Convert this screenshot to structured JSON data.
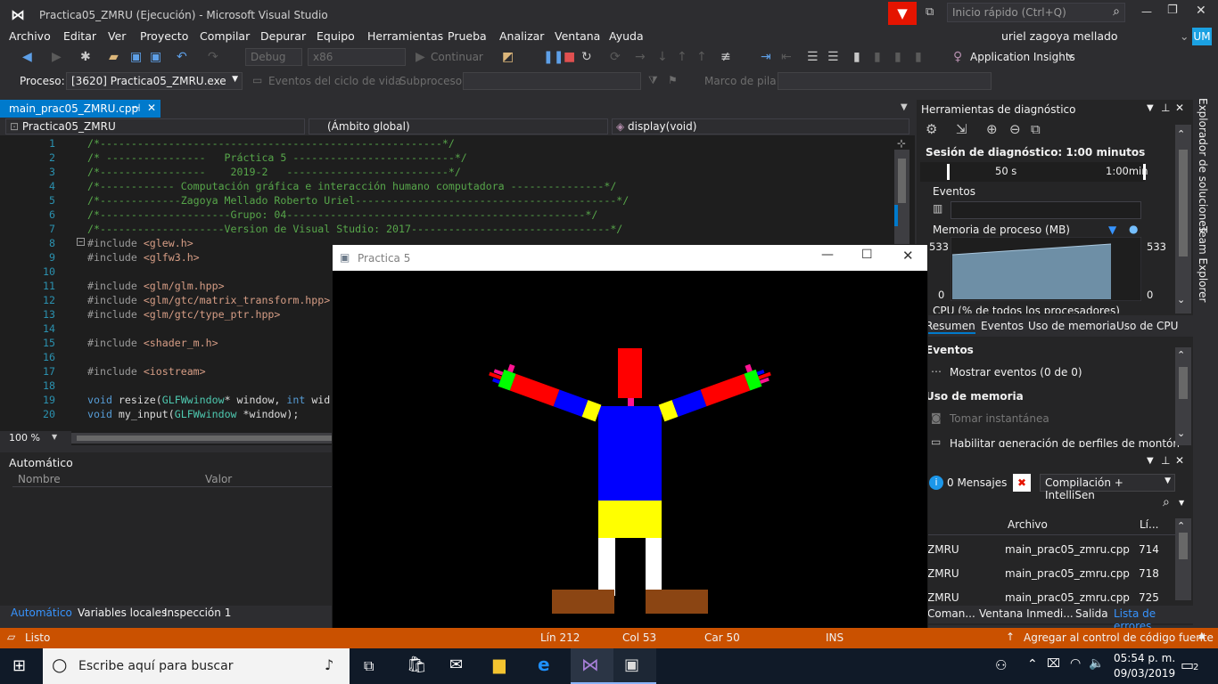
{
  "app": {
    "title": "Practica05_ZMRU (Ejecución) - Microsoft Visual Studio",
    "quick_launch_placeholder": "Inicio rápido (Ctrl+Q)",
    "user": "uriel zagoya mellado",
    "user_initials": "UM"
  },
  "menu": [
    "Archivo",
    "Editar",
    "Ver",
    "Proyecto",
    "Compilar",
    "Depurar",
    "Equipo",
    "Herramientas",
    "Prueba",
    "Analizar",
    "Ventana",
    "Ayuda"
  ],
  "toolbar": {
    "config": "Debug",
    "platform": "x86",
    "continue_label": "Continuar",
    "app_insights": "Application Insights"
  },
  "procbar": {
    "proceso_label": "Proceso:",
    "proceso_value": "[3620] Practica05_ZMRU.exe",
    "eventos_label": "Eventos del ciclo de vida",
    "subproceso_label": "Subproceso:",
    "marco_label": "Marco de pila:"
  },
  "editor": {
    "tab": "main_prac05_ZMRU.cpp",
    "nav_project": "Practica05_ZMRU",
    "nav_scope": "(Ámbito global)",
    "nav_func": "display(void)",
    "zoom": "100 %",
    "lines": [
      {
        "n": "1",
        "t": "/*-------------------------------------------------------*/",
        "c": "cm"
      },
      {
        "n": "2",
        "t": "/* ----------------   Práctica 5 --------------------------*/",
        "c": "cm"
      },
      {
        "n": "3",
        "t": "/*-----------------    2019-2   --------------------------*/",
        "c": "cm"
      },
      {
        "n": "4",
        "t": "/*------------ Computación gráfica e interacción humano computadora ---------------*/",
        "c": "cm"
      },
      {
        "n": "5",
        "t": "/*-------------Zagoya Mellado Roberto Uriel------------------------------------------*/",
        "c": "cm"
      },
      {
        "n": "6",
        "t": "/*---------------------Grupo: 04------------------------------------------------*/",
        "c": "cm"
      },
      {
        "n": "7",
        "t": "/*--------------------Version de Visual Studio: 2017--------------------------------*/",
        "c": "cm"
      },
      {
        "n": "8",
        "t": "#include <glew.h>",
        "c": "inc"
      },
      {
        "n": "9",
        "t": "#include <glfw3.h>",
        "c": "inc"
      },
      {
        "n": "10",
        "t": "",
        "c": "pl"
      },
      {
        "n": "11",
        "t": "#include <glm/glm.hpp>",
        "c": "inc"
      },
      {
        "n": "12",
        "t": "#include <glm/gtc/matrix_transform.hpp>",
        "c": "inc"
      },
      {
        "n": "13",
        "t": "#include <glm/gtc/type_ptr.hpp>",
        "c": "inc"
      },
      {
        "n": "14",
        "t": "",
        "c": "pl"
      },
      {
        "n": "15",
        "t": "#include <shader_m.h>",
        "c": "inc"
      },
      {
        "n": "16",
        "t": "",
        "c": "pl"
      },
      {
        "n": "17",
        "t": "#include <iostream>",
        "c": "inc"
      },
      {
        "n": "18",
        "t": "",
        "c": "pl"
      },
      {
        "n": "19",
        "t": "void resize(GLFWwindow* window, int wid",
        "c": "fn"
      },
      {
        "n": "20",
        "t": "void my_input(GLFWwindow *window);",
        "c": "fn"
      }
    ]
  },
  "autos": {
    "title": "Automático",
    "col_name": "Nombre",
    "col_value": "Valor"
  },
  "bottom_tabs": [
    "Automático",
    "Variables locales",
    "Inspección 1"
  ],
  "diag": {
    "title": "Herramientas de diagnóstico",
    "session": "Sesión de diagnóstico: 1:00 minutos",
    "t1": "50 s",
    "t2": "1:00min",
    "eventos": "Eventos",
    "memoria": "Memoria de proceso (MB)",
    "mem_top": "533",
    "mem_bottom": "0",
    "cpu": "CPU (% de todos los procesadores)",
    "tabs": [
      "Resumen",
      "Eventos",
      "Uso de memoria",
      "Uso de CPU"
    ],
    "sec_eventos": "Eventos",
    "mostrar": "Mostrar eventos (0 de 0)",
    "sec_uso": "Uso de memoria",
    "tomar": "Tomar instantánea",
    "habilitar": "Habilitar generación de perfiles de montón (a"
  },
  "errors": {
    "mensajes": "0 Mensajes",
    "filter": "Compilación + IntelliSen",
    "col_archivo": "Archivo",
    "col_linea": "Lí...",
    "rows": [
      {
        "proj": "ZMRU",
        "file": "main_prac05_zmru.cpp",
        "line": "714"
      },
      {
        "proj": "ZMRU",
        "file": "main_prac05_zmru.cpp",
        "line": "718"
      },
      {
        "proj": "ZMRU",
        "file": "main_prac05_zmru.cpp",
        "line": "725"
      }
    ],
    "tabs": [
      "Coman...",
      "Ventana Inmedi...",
      "Salida",
      "Lista de errores"
    ]
  },
  "side_tabs": [
    "Explorador de soluciones",
    "Team Explorer"
  ],
  "glwindow": {
    "title": "Practica 5"
  },
  "status": {
    "ready": "Listo",
    "ln": "Lín 212",
    "col": "Col 53",
    "car": "Car 50",
    "ins": "INS",
    "source_control": "Agregar al control de código fuente"
  },
  "taskbar": {
    "search_placeholder": "Escribe aquí para buscar",
    "time": "05:54 p. m.",
    "date": "09/03/2019",
    "notif": "2"
  },
  "colors": {
    "accent": "#ca5100",
    "blue": "#007acc",
    "figure_red": "#ff0000",
    "figure_blue": "#0000ff",
    "figure_yellow": "#ffff00",
    "figure_green": "#00ff00",
    "figure_brown": "#8b4513"
  }
}
